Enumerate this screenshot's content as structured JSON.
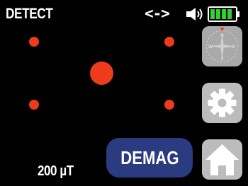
{
  "header": {
    "mode_title": "DETECT",
    "link_status": "<->",
    "icons": {
      "speaker": "speaker-volume-icon",
      "battery": "battery-full-icon"
    }
  },
  "detector": {
    "sensor_dots": [
      "top-left",
      "top-right",
      "center",
      "bottom-left",
      "bottom-right"
    ],
    "dot_color": "#ef3a1e"
  },
  "buttons": {
    "compass": {
      "label_n": "N",
      "label_e": "E",
      "label_s": "S",
      "label_w": "W"
    },
    "settings_icon": "gear-icon",
    "home_icon": "home-icon",
    "demag_label": "DEMAG"
  },
  "readout": {
    "field_strength": "200 µT"
  },
  "colors": {
    "background": "#000000",
    "accent_red": "#ef3a1e",
    "demag_blue": "#2a3b7f",
    "battery_green": "#2fd12f"
  }
}
